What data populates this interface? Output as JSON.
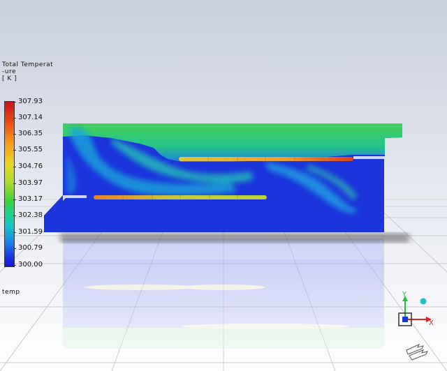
{
  "legend": {
    "title_lines": [
      "Total Temperat",
      "-ure",
      "[ K ]"
    ],
    "ticks": [
      "307.93",
      "307.14",
      "306.35",
      "305.55",
      "304.76",
      "303.97",
      "303.17",
      "302.38",
      "301.59",
      "300.79",
      "300.00"
    ],
    "colormap": [
      "#c8141a",
      "#f59a1e",
      "#e6d72a",
      "#3fd23a",
      "#19c2c8",
      "#1c3ee0",
      "#1414d9"
    ]
  },
  "scene": {
    "object_label": "temp"
  },
  "axes": {
    "x_label": "X",
    "y_label": "Y",
    "x_color": "#e02020",
    "y_color": "#1fbf3a",
    "z_color": "#1a3ad8"
  },
  "icons": [
    "axis-triad-icon",
    "rotate-arrows-icon",
    "light-sphere-icon"
  ]
}
